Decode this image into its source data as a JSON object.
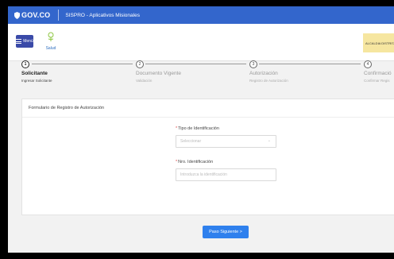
{
  "govbar": {
    "logo_text": "GOV.CO",
    "app_title": "SISPRO - Aplicativos Misionales"
  },
  "navbar": {
    "menu_label": "Menú",
    "salud_label": "Salud",
    "alcaldia_text": "ALCALDIA DISTRITAL"
  },
  "steps": [
    {
      "number": "1",
      "title": "Solicitante",
      "subtitle": "Ingresar Solicitante",
      "active": true
    },
    {
      "number": "2",
      "title": "Documento Vigente",
      "subtitle": "Validación",
      "active": false
    },
    {
      "number": "3",
      "title": "Autorización",
      "subtitle": "Registro de Autorización",
      "active": false
    },
    {
      "number": "4",
      "title": "Confirmació",
      "subtitle": "Confirmar Regis",
      "active": false
    }
  ],
  "form": {
    "title": "Formulario de Registro de Autorización",
    "required_mark": "*",
    "tipo_label": "Tipo de Identificación",
    "tipo_placeholder": "Seleccionar",
    "nro_label": "Nro. Identificación",
    "nro_placeholder": "Introduzca la identificación"
  },
  "actions": {
    "next_label": "Paso Siguiente >"
  },
  "colors": {
    "brand_blue": "#3366cc",
    "menu_blue": "#3a4aa8",
    "button_blue": "#2f80ed",
    "salud_green": "#8cc63f"
  }
}
